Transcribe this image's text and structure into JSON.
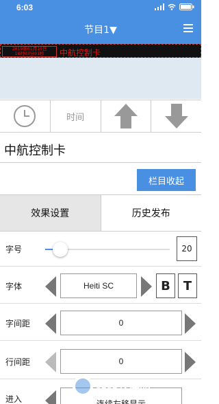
{
  "status": {
    "time": "6:03"
  },
  "nav": {
    "title": "节目1▼"
  },
  "led": {
    "line1": "2019年01月10日",
    "line2": "18时03分01秒",
    "text": "中航控制卡"
  },
  "tools": {
    "time_label": "时间"
  },
  "program_name": "中航控制卡",
  "collapse_label": "栏目收起",
  "tabs": [
    {
      "label": "效果设置"
    },
    {
      "label": "历史发布"
    }
  ],
  "font_size": {
    "label": "字号",
    "value": "20",
    "slider_fraction": 0.12
  },
  "font_family": {
    "label": "字体",
    "value": "Heiti SC",
    "bold_label": "B",
    "italic_label": "T"
  },
  "char_spacing": {
    "label": "字间距",
    "value": "0"
  },
  "line_spacing": {
    "label": "行间距",
    "value": "0"
  },
  "enter": {
    "label": "进入",
    "value": "连续左移显示"
  },
  "watermark": {
    "text": "西西软件园",
    "sub": "CR173.COM"
  },
  "colors": {
    "accent": "#4a90e2",
    "led_red": "#e11111"
  }
}
